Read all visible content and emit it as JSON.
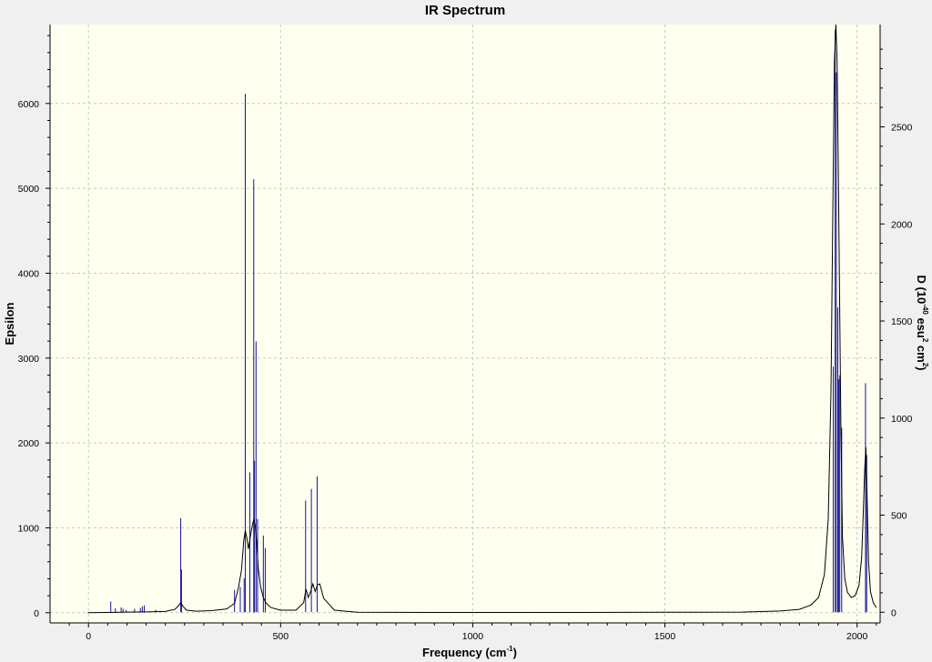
{
  "chart_data": {
    "type": "line",
    "title": "IR Spectrum",
    "xlabel_text": "Frequency (cm",
    "xlabel_sup": "-1",
    "xlabel_end": ")",
    "ylabel_left": "Epsilon",
    "ylabel_right_parts": [
      "D (10",
      "-40",
      " esu",
      "2",
      " cm",
      "2",
      ")"
    ],
    "xlim": [
      -100,
      2060
    ],
    "ylim_left": [
      -120,
      6930
    ],
    "ylim_right": [
      -55,
      3027
    ],
    "x_ticks": [
      0,
      500,
      1000,
      1500,
      2000
    ],
    "y_left_ticks": [
      0,
      1000,
      2000,
      3000,
      4000,
      5000,
      6000
    ],
    "y_right_ticks": [
      0,
      500,
      1000,
      1500,
      2000,
      2500
    ],
    "grid": true,
    "plot_background": "#fffff0",
    "stick_color": "#14149a",
    "curve_color": "#000000",
    "series": [
      {
        "kind": "sticks",
        "axis": "right",
        "x": [
          58,
          70,
          85,
          90,
          98,
          120,
          135,
          140,
          145,
          175,
          240,
          242,
          380,
          395,
          405,
          408,
          420,
          430,
          432,
          436,
          440,
          455,
          460,
          565,
          580,
          595,
          1938,
          1943,
          1946,
          1950,
          1952,
          1955,
          1960,
          2022,
          2025
        ],
        "values": [
          55,
          20,
          25,
          18,
          12,
          18,
          22,
          30,
          35,
          12,
          485,
          220,
          115,
          130,
          175,
          2670,
          720,
          2230,
          780,
          1395,
          480,
          395,
          330,
          575,
          635,
          700,
          1265,
          3000,
          2780,
          1570,
          1200,
          1220,
          950,
          1180,
          810
        ]
      },
      {
        "kind": "envelope",
        "axis": "left",
        "x": [
          -2,
          50,
          100,
          150,
          200,
          225,
          235,
          240,
          245,
          255,
          280,
          320,
          360,
          380,
          390,
          398,
          404,
          408,
          412,
          416,
          420,
          425,
          430,
          434,
          438,
          442,
          448,
          455,
          460,
          466,
          475,
          500,
          540,
          560,
          566,
          572,
          578,
          584,
          590,
          596,
          602,
          612,
          640,
          700,
          900,
          1200,
          1500,
          1700,
          1800,
          1850,
          1880,
          1900,
          1915,
          1925,
          1932,
          1937,
          1941,
          1945,
          1948,
          1951,
          1954,
          1958,
          1962,
          1968,
          1975,
          1985,
          1995,
          2005,
          2012,
          2016,
          2020,
          2023,
          2026,
          2030,
          2035,
          2042,
          2050
        ],
        "values": [
          0,
          3,
          8,
          10,
          15,
          40,
          85,
          120,
          80,
          30,
          18,
          25,
          45,
          110,
          290,
          500,
          850,
          970,
          880,
          750,
          870,
          1000,
          1100,
          1020,
          800,
          520,
          300,
          180,
          130,
          95,
          60,
          30,
          30,
          120,
          280,
          180,
          250,
          340,
          250,
          330,
          340,
          170,
          30,
          5,
          3,
          3,
          5,
          8,
          20,
          40,
          90,
          180,
          450,
          1100,
          2600,
          4800,
          6500,
          6930,
          6500,
          5300,
          4000,
          2200,
          900,
          400,
          240,
          180,
          200,
          320,
          650,
          1150,
          1700,
          1950,
          1400,
          600,
          250,
          120,
          60
        ]
      }
    ]
  }
}
